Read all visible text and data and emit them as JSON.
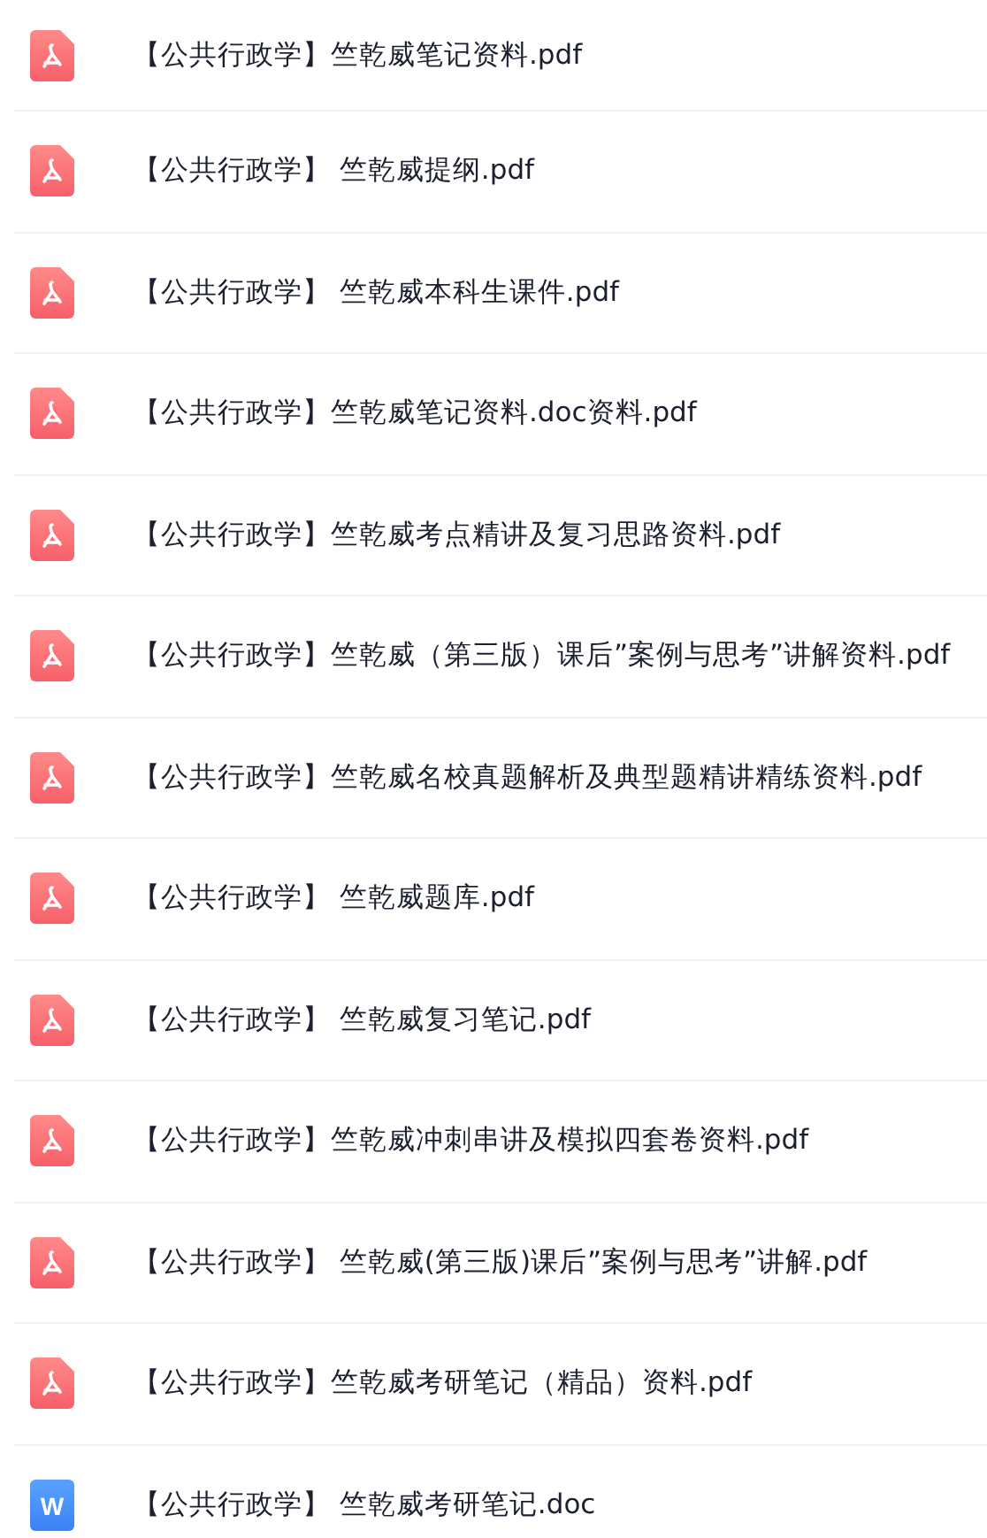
{
  "files": [
    {
      "kind": "pdf",
      "name": "【公共行政学】竺乾威笔记资料.pdf"
    },
    {
      "kind": "pdf",
      "name": "【公共行政学】 竺乾威提纲.pdf"
    },
    {
      "kind": "pdf",
      "name": "【公共行政学】 竺乾威本科生课件.pdf"
    },
    {
      "kind": "pdf",
      "name": "【公共行政学】竺乾威笔记资料.doc资料.pdf"
    },
    {
      "kind": "pdf",
      "name": "【公共行政学】竺乾威考点精讲及复习思路资料.pdf"
    },
    {
      "kind": "pdf",
      "name": "【公共行政学】竺乾威（第三版）课后”案例与思考”讲解资料.pdf"
    },
    {
      "kind": "pdf",
      "name": "【公共行政学】竺乾威名校真题解析及典型题精讲精练资料.pdf"
    },
    {
      "kind": "pdf",
      "name": "【公共行政学】 竺乾威题库.pdf"
    },
    {
      "kind": "pdf",
      "name": "【公共行政学】 竺乾威复习笔记.pdf"
    },
    {
      "kind": "pdf",
      "name": "【公共行政学】竺乾威冲刺串讲及模拟四套卷资料.pdf"
    },
    {
      "kind": "pdf",
      "name": "【公共行政学】 竺乾威(第三版)课后”案例与思考”讲解.pdf"
    },
    {
      "kind": "pdf",
      "name": "【公共行政学】竺乾威考研笔记（精品）资料.pdf"
    },
    {
      "kind": "doc",
      "badge": "W",
      "name": "【公共行政学】 竺乾威考研笔记.doc"
    }
  ]
}
